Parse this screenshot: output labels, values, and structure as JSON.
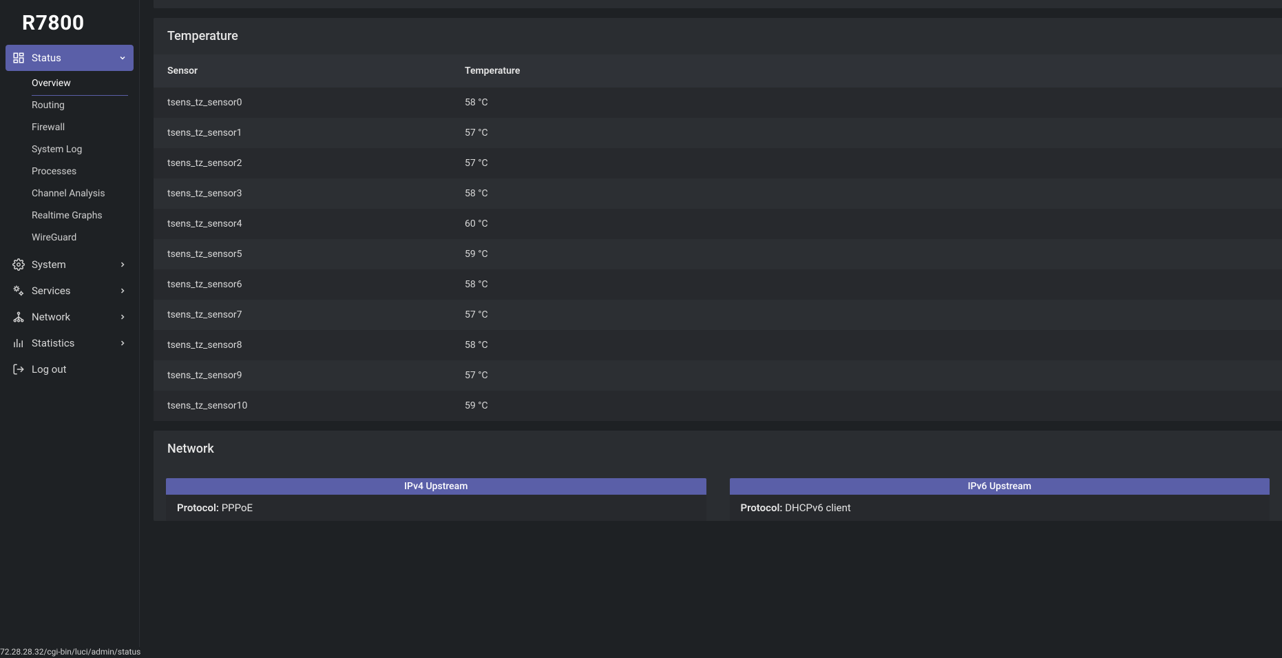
{
  "brand": "R7800",
  "sidebar": {
    "status": {
      "label": "Status",
      "items": [
        {
          "label": "Overview"
        },
        {
          "label": "Routing"
        },
        {
          "label": "Firewall"
        },
        {
          "label": "System Log"
        },
        {
          "label": "Processes"
        },
        {
          "label": "Channel Analysis"
        },
        {
          "label": "Realtime Graphs"
        },
        {
          "label": "WireGuard"
        }
      ]
    },
    "system": {
      "label": "System"
    },
    "services": {
      "label": "Services"
    },
    "network": {
      "label": "Network"
    },
    "statistics": {
      "label": "Statistics"
    },
    "logout": {
      "label": "Log out"
    }
  },
  "temperature": {
    "title": "Temperature",
    "headers": {
      "sensor": "Sensor",
      "temp": "Temperature"
    },
    "rows": [
      {
        "sensor": "tsens_tz_sensor0",
        "temp": "58 °C"
      },
      {
        "sensor": "tsens_tz_sensor1",
        "temp": "57 °C"
      },
      {
        "sensor": "tsens_tz_sensor2",
        "temp": "57 °C"
      },
      {
        "sensor": "tsens_tz_sensor3",
        "temp": "58 °C"
      },
      {
        "sensor": "tsens_tz_sensor4",
        "temp": "60 °C"
      },
      {
        "sensor": "tsens_tz_sensor5",
        "temp": "59 °C"
      },
      {
        "sensor": "tsens_tz_sensor6",
        "temp": "58 °C"
      },
      {
        "sensor": "tsens_tz_sensor7",
        "temp": "57 °C"
      },
      {
        "sensor": "tsens_tz_sensor8",
        "temp": "58 °C"
      },
      {
        "sensor": "tsens_tz_sensor9",
        "temp": "57 °C"
      },
      {
        "sensor": "tsens_tz_sensor10",
        "temp": "59 °C"
      }
    ]
  },
  "network": {
    "title": "Network",
    "ipv4": {
      "header": "IPv4 Upstream",
      "protocol_label": "Protocol:",
      "protocol_value": "PPPoE"
    },
    "ipv6": {
      "header": "IPv6 Upstream",
      "protocol_label": "Protocol:",
      "protocol_value": "DHCPv6 client"
    }
  },
  "status_url": "72.28.28.32/cgi-bin/luci/admin/status"
}
